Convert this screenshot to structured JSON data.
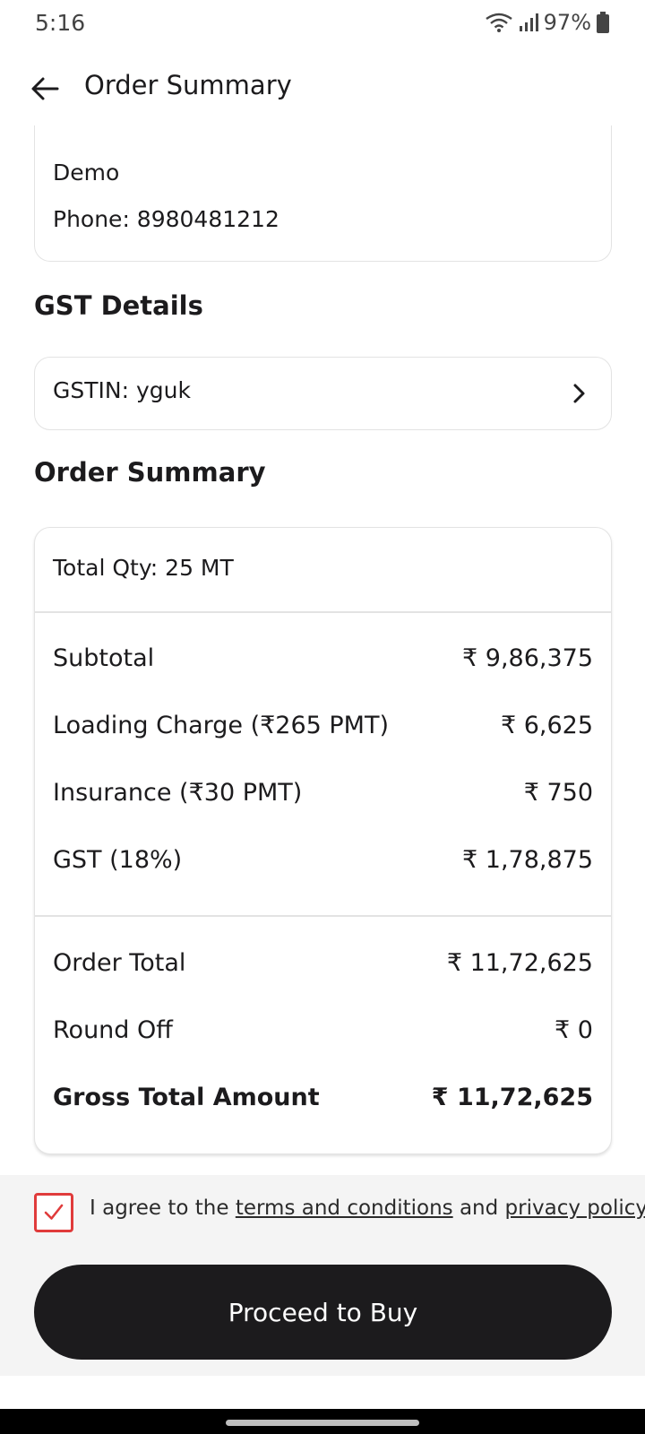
{
  "status_bar": {
    "time": "5:16",
    "battery": "97%",
    "icons": [
      "wifi-icon",
      "signal-icon",
      "battery-icon"
    ]
  },
  "header": {
    "title": "Order Summary",
    "back_icon": "arrow-left-icon"
  },
  "address": {
    "name": "Demo",
    "phone": "Phone: 8980481212"
  },
  "gst": {
    "section_title": "GST Details",
    "gstin": "GSTIN: yguk",
    "chevron_icon": "chevron-right-icon"
  },
  "summary": {
    "section_title": "Order Summary",
    "total_qty": "Total Qty: 25 MT",
    "charges": [
      {
        "label": "Subtotal",
        "value": "₹ 9,86,375"
      },
      {
        "label": "Loading Charge (₹265 PMT)",
        "value": "₹ 6,625"
      },
      {
        "label": "Insurance (₹30 PMT)",
        "value": "₹ 750"
      },
      {
        "label": "GST (18%)",
        "value": "₹ 1,78,875"
      }
    ],
    "totals": [
      {
        "label": "Order Total",
        "value": "₹ 11,72,625"
      },
      {
        "label": "Round Off",
        "value": "₹ 0"
      }
    ],
    "gross": {
      "label": "Gross Total Amount",
      "value": "₹ 11,72,625"
    }
  },
  "agreement": {
    "checked": true,
    "prefix": "I agree to the ",
    "terms_link": "terms and conditions",
    "middle": " and ",
    "privacy_link": "privacy policy",
    "accent_color": "#e03b3b"
  },
  "cta": {
    "label": "Proceed to Buy",
    "color": "#1c1b1d"
  }
}
